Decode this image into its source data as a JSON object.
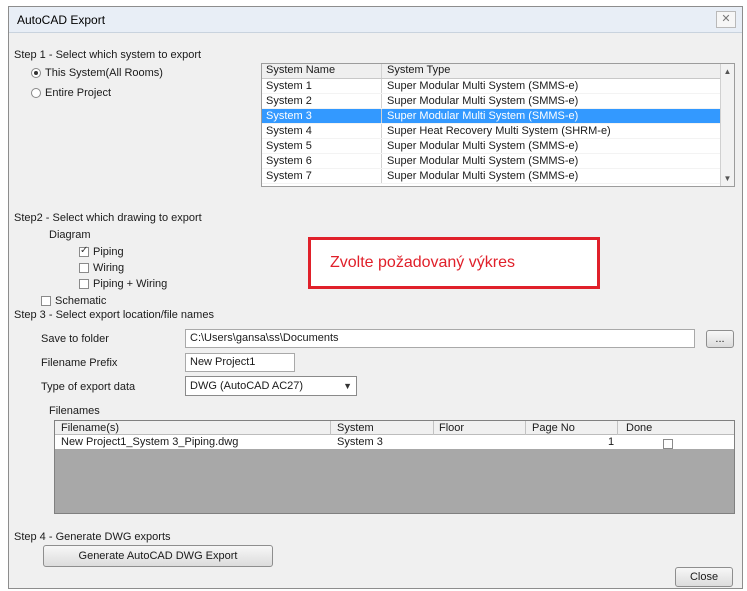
{
  "window": {
    "title": "AutoCAD Export",
    "close_glyph": "✕"
  },
  "step1": {
    "label": "Step 1 - Select which system to export",
    "option_this": "This System(All Rooms)",
    "option_entire": "Entire Project",
    "table": {
      "headers": [
        "System Name",
        "System Type"
      ],
      "rows": [
        {
          "name": "System 1",
          "type": "Super Modular Multi System (SMMS-e)"
        },
        {
          "name": "System 2",
          "type": "Super Modular Multi System (SMMS-e)"
        },
        {
          "name": "System 3",
          "type": "Super Modular Multi System (SMMS-e)"
        },
        {
          "name": "System 4",
          "type": "Super Heat Recovery Multi System (SHRM-e)"
        },
        {
          "name": "System 5",
          "type": "Super Modular Multi System (SMMS-e)"
        },
        {
          "name": "System 6",
          "type": "Super Modular Multi System (SMMS-e)"
        },
        {
          "name": "System 7",
          "type": "Super Modular Multi System (SMMS-e)"
        }
      ],
      "selected_index": 2
    }
  },
  "step2": {
    "label": "Step2 - Select which drawing to export",
    "diagram_label": "Diagram",
    "piping": "Piping",
    "wiring": "Wiring",
    "piping_wiring": "Piping + Wiring",
    "schematic": "Schematic",
    "piping_checked": true
  },
  "callout": {
    "text": "Zvolte požadovaný výkres",
    "color": "#e0202a"
  },
  "step3": {
    "label": "Step 3 - Select export location/file names",
    "save_label": "Save to folder",
    "save_value": "C:\\Users\\gansa\\ss\\Documents",
    "browse_label": "...",
    "prefix_label": "Filename Prefix",
    "prefix_value": "New Project1",
    "type_label": "Type of export data",
    "type_value": "DWG (AutoCAD AC27)",
    "filenames_label": "Filenames",
    "grid": {
      "headers": [
        "Filename(s)",
        "System",
        "Floor",
        "Page No",
        "Done"
      ],
      "row": {
        "filename": "New Project1_System 3_Piping.dwg",
        "system": "System 3",
        "floor": "",
        "page": "1",
        "done": false
      }
    }
  },
  "step4": {
    "label": "Step 4 - Generate DWG exports",
    "generate_label": "Generate AutoCAD DWG Export"
  },
  "close_label": "Close",
  "colors": {
    "selection": "#3399ff",
    "accent_red": "#e0202a"
  }
}
